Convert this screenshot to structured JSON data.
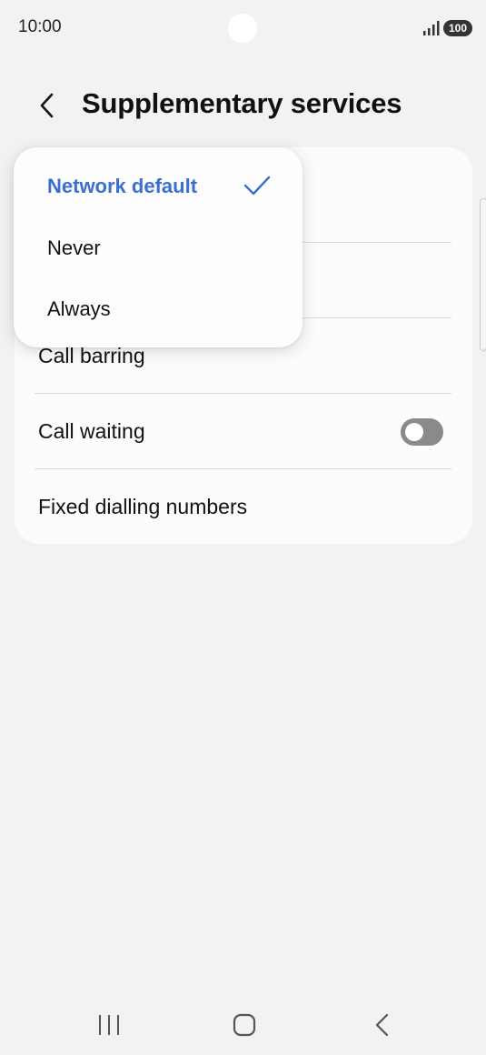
{
  "status": {
    "time": "10:00",
    "battery": "100"
  },
  "header": {
    "title": "Supplementary services"
  },
  "settings": {
    "items": [
      {
        "label": ""
      },
      {
        "label": ""
      },
      {
        "label": "Call barring"
      },
      {
        "label": "Call waiting",
        "toggle_on": false
      },
      {
        "label": "Fixed dialling numbers"
      }
    ]
  },
  "dropdown": {
    "options": [
      {
        "label": "Network default",
        "selected": true
      },
      {
        "label": "Never",
        "selected": false
      },
      {
        "label": "Always",
        "selected": false
      }
    ]
  },
  "icons": {
    "back": "chevron-left-icon",
    "check": "check-icon",
    "signal": "signal-icon",
    "nav_recents": "recents-icon",
    "nav_home": "home-icon",
    "nav_back": "back-icon"
  },
  "colors": {
    "accent": "#3a6fd0",
    "background": "#f2f2f4",
    "card": "#fcfcfe",
    "toggle_off": "#8a8a8d"
  }
}
